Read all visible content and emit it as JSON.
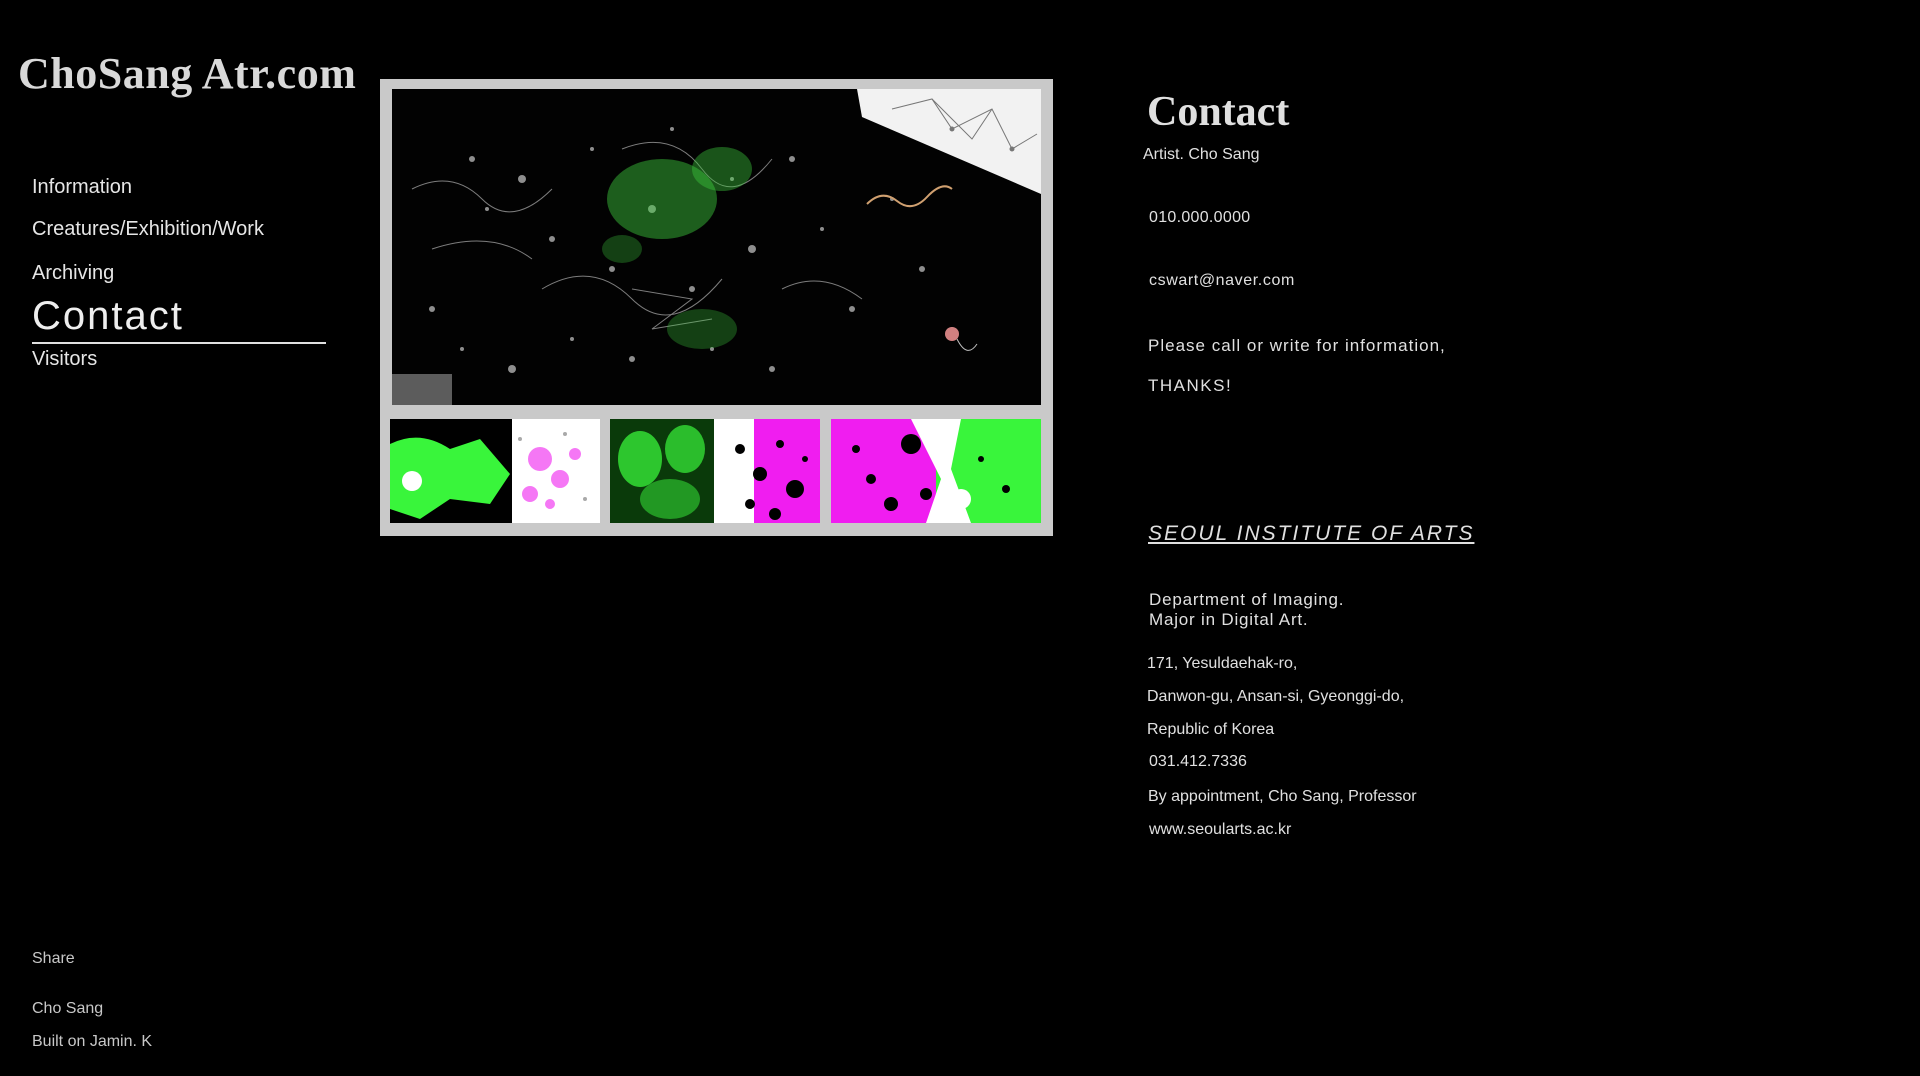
{
  "site": {
    "title": "ChoSang Atr.com"
  },
  "nav": {
    "items": [
      {
        "label": "Information"
      },
      {
        "label": "Creatures/Exhibition/Work"
      },
      {
        "label": "Archiving"
      },
      {
        "label": "Contact"
      },
      {
        "label": "Visitors"
      }
    ],
    "active": "Contact"
  },
  "footer": {
    "share": "Share",
    "credit_name": "Cho Sang",
    "credit_built": "Built on Jamin. K"
  },
  "gallery": {
    "main_image": "digital-art-artwork",
    "thumbnails": [
      "green-magenta-artwork-1",
      "green-magenta-artwork-2",
      "magenta-green-artwork-3"
    ],
    "colors": {
      "frame": "#c9c9c9",
      "green": "#39f53b",
      "magenta": "#f01df0"
    }
  },
  "contact": {
    "title": "Contact",
    "artist": "Artist. Cho Sang",
    "phone": "010.000.0000",
    "email": "cswart@naver.com",
    "note": "Please call or write for information,",
    "thanks": "THANKS!",
    "institute": "SEOUL INSTITUTE OF ARTS",
    "department": "Department of Imaging.",
    "major": "Major in Digital Art.",
    "address_1": "171, Yesuldaehak-ro,",
    "address_2": "Danwon-gu, Ansan-si, Gyeonggi-do,",
    "address_3": "Republic of Korea",
    "phone_2": "031.412.7336",
    "appointment": "By appointment, Cho Sang, Professor",
    "website": "www.seoularts.ac.kr"
  }
}
